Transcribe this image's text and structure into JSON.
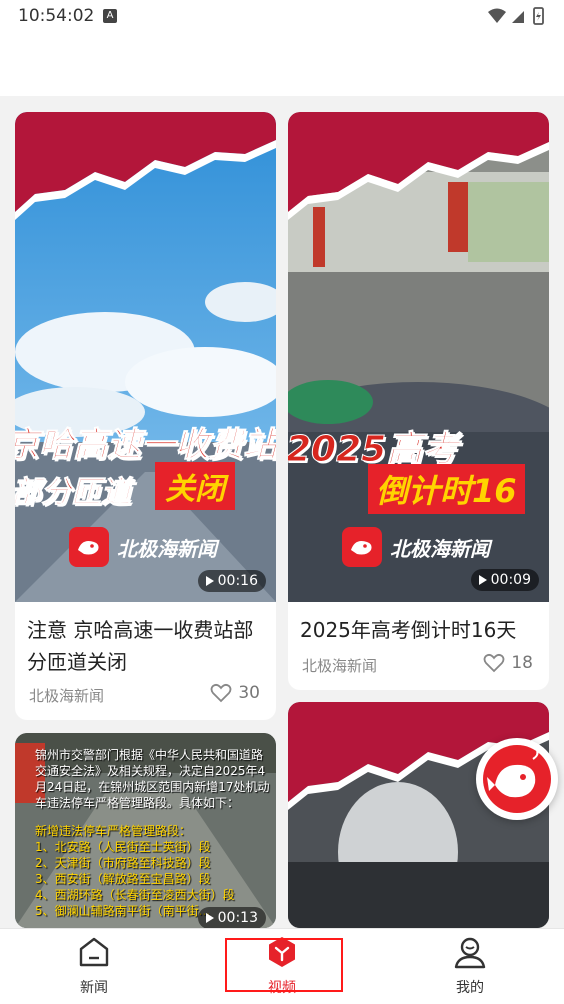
{
  "status_bar": {
    "time": "10:54:02",
    "notification_badge": "A"
  },
  "feed": [
    {
      "title": "注意 京哈高速一收费站部分匝道关闭",
      "source": "北极海新闻",
      "likes": "30",
      "duration": "00:16",
      "overlay_line1": "京哈高速一收费站",
      "overlay_line2": "部分匝道",
      "overlay_tag": "关闭"
    },
    {
      "title": "2025年高考倒计时16天",
      "source": "北极海新闻",
      "likes": "18",
      "duration": "00:09",
      "overlay_line1": "2025高考",
      "overlay_line2": "倒计时16"
    },
    {
      "duration": "00:13",
      "notice_intro": "锦州市交警部门根据《中华人民共和国道路交通安全法》及相关规程，决定自2025年4月24日起，在锦州城区范围内新增17处机动车违法停车严格管理路段。具体如下：",
      "notice_heading": "新增违法停车严格管理路段：",
      "notice_items": [
        "1、北安路（人民街至士英街）段",
        "2、天津街（市府路至科技路）段",
        "3、西安街（解放路至宝昌路）段",
        "4、西湖环路（长春街至凌西大街）段",
        "5、御澜山辅路南平街（南平街..."
      ]
    },
    {}
  ],
  "brand_watermark": "北极海新闻",
  "nav": {
    "items": [
      {
        "label": "新闻"
      },
      {
        "label": "视频"
      },
      {
        "label": "我的"
      }
    ]
  },
  "colors": {
    "accent": "#e6222a",
    "banner": "#b3163a"
  }
}
